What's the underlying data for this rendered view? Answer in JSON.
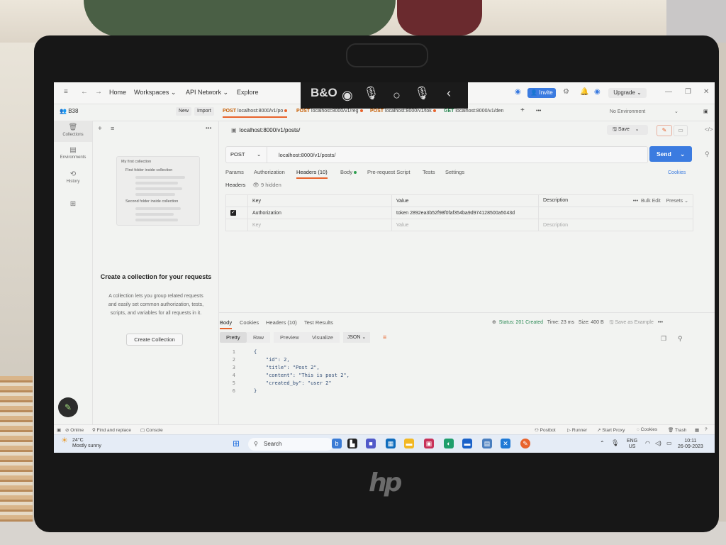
{
  "titlebar": {
    "nav": [
      "Home",
      "Workspaces",
      "API Network",
      "Explore"
    ],
    "invite": "Invite",
    "upgrade": "Upgrade"
  },
  "workspace": {
    "name": "B38",
    "new_label": "New",
    "import_label": "Import",
    "environment": "No Environment"
  },
  "tabs": [
    {
      "method": "POST",
      "label": "localhost:8000/v1/po"
    },
    {
      "method": "POST",
      "label": "localhost:8000/v1/reg"
    },
    {
      "method": "POST",
      "label": "localhost:8000/v1/tok"
    },
    {
      "method": "GET",
      "label": "localhost:8000/v1/den"
    }
  ],
  "sidebar": {
    "rail": [
      "Collections",
      "Environments",
      "History"
    ],
    "illustration": {
      "collection": "My first collection",
      "folder1": "First folder inside collection",
      "folder2": "Second folder inside collection"
    },
    "empty_title": "Create a collection for your requests",
    "empty_desc": "A collection lets you group related requests and easily set common authorization, tests, scripts, and variables for all requests in it.",
    "create_button": "Create Collection"
  },
  "request": {
    "title": "localhost:8000/v1/posts/",
    "save": "Save",
    "method": "POST",
    "url": "localhost:8000/v1/posts/",
    "send": "Send",
    "tabs": [
      "Params",
      "Authorization",
      "Headers (10)",
      "Body",
      "Pre-request Script",
      "Tests",
      "Settings"
    ],
    "cookies": "Cookies",
    "headers_label": "Headers",
    "hidden": "9 hidden",
    "table": {
      "columns": [
        "Key",
        "Value",
        "Description"
      ],
      "bulk_edit": "Bulk Edit",
      "presets": "Presets",
      "rows": [
        {
          "key": "Authorization",
          "value": "token 2892ea3b52f98f0faf354ba9d974128500a5043d",
          "description": ""
        }
      ],
      "placeholder": {
        "key": "Key",
        "value": "Value",
        "description": "Description"
      }
    }
  },
  "response": {
    "tabs": [
      "Body",
      "Cookies",
      "Headers (10)",
      "Test Results"
    ],
    "status": "Status: 201 Created",
    "time": "Time: 23 ms",
    "size": "Size: 400 B",
    "save_example": "Save as Example",
    "formats": [
      "Pretty",
      "Raw",
      "Preview",
      "Visualize"
    ],
    "lang": "JSON",
    "code_lines": [
      {
        "n": "1",
        "t": "{"
      },
      {
        "n": "2",
        "t": "    \"id\": 2,"
      },
      {
        "n": "3",
        "t": "    \"title\": \"Post 2\","
      },
      {
        "n": "4",
        "t": "    \"content\": \"This is post 2\","
      },
      {
        "n": "5",
        "t": "    \"created_by\": \"user 2\""
      },
      {
        "n": "6",
        "t": "}"
      }
    ]
  },
  "statusbar": {
    "online": "Online",
    "find": "Find and replace",
    "console": "Console",
    "right": [
      "Postbot",
      "Runner",
      "Start Proxy",
      "Cookies",
      "Trash"
    ]
  },
  "taskbar": {
    "temp": "24°C",
    "weather": "Mostly sunny",
    "search": "Search",
    "lang1": "ENG",
    "lang2": "US",
    "time": "10:11",
    "date": "26-09-2023"
  }
}
